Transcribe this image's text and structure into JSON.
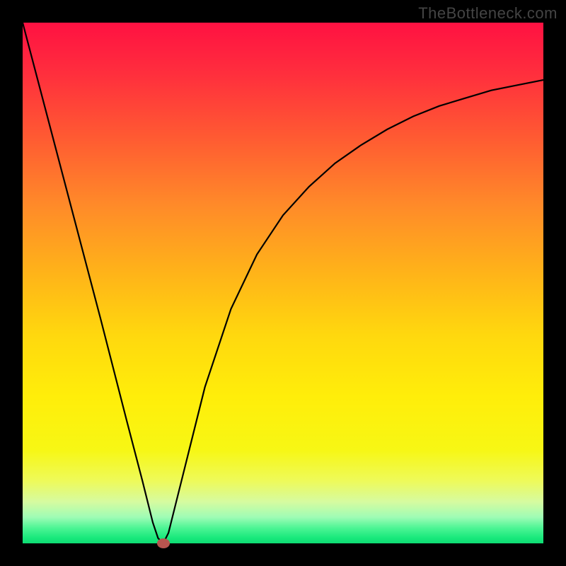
{
  "watermark": "TheBottleneck.com",
  "chart_data": {
    "type": "line",
    "title": "",
    "xlabel": "",
    "ylabel": "",
    "xlim": [
      0,
      100
    ],
    "ylim": [
      0,
      100
    ],
    "background_gradient": [
      "#ff1142",
      "#ffee0a",
      "#0fdb73"
    ],
    "series": [
      {
        "name": "bottleneck-curve",
        "x": [
          0,
          5,
          10,
          15,
          20,
          23,
          25,
          26,
          27,
          28,
          30,
          35,
          40,
          45,
          50,
          55,
          60,
          65,
          70,
          75,
          80,
          85,
          90,
          95,
          100
        ],
        "y": [
          100,
          81,
          62,
          43,
          23.5,
          12,
          4,
          1,
          0,
          2,
          10,
          30,
          45,
          55.5,
          63,
          68.5,
          73,
          76.5,
          79.5,
          82,
          84,
          85.5,
          87,
          88,
          89
        ]
      }
    ],
    "marker": {
      "x": 27,
      "y": 0,
      "color": "#b8554f"
    }
  }
}
